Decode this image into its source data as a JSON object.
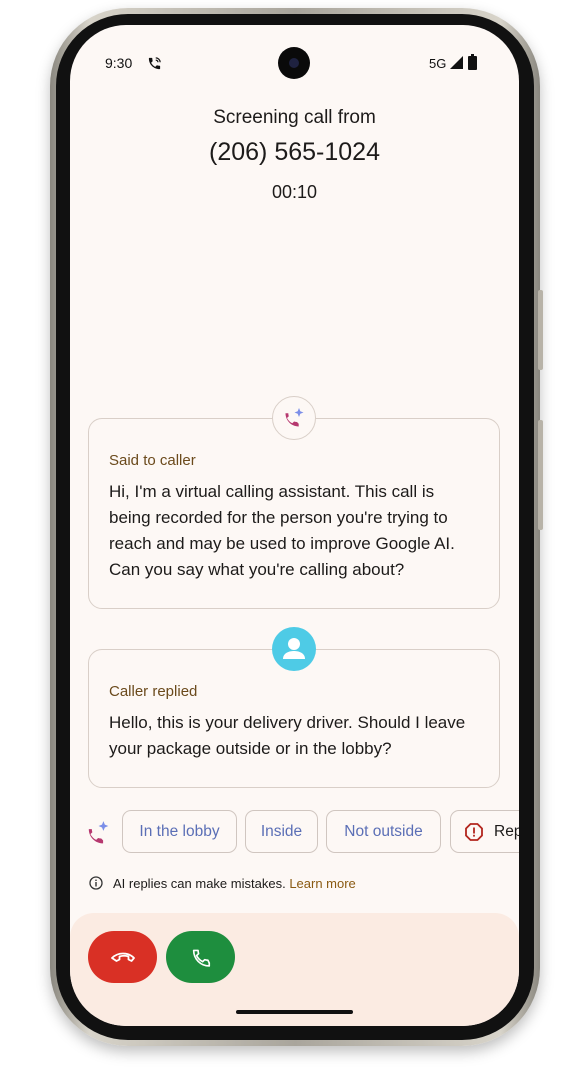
{
  "status_bar": {
    "time": "9:30",
    "network": "5G",
    "icons": [
      "call-in-progress-icon",
      "signal-icon",
      "battery-icon"
    ]
  },
  "header": {
    "title": "Screening call from",
    "phone_number": "(206) 565-1024",
    "timer": "00:10"
  },
  "messages": [
    {
      "label": "Said to caller",
      "text": "Hi, I'm a virtual calling assistant. This call is being recorded for the person you're trying to reach and may be used to improve Google AI. Can you say what you're calling about?",
      "icon": "ai-phone-sparkle-icon"
    },
    {
      "label": "Caller replied",
      "text": "Hello, this is your delivery driver. Should I leave your package outside or in the lobby?",
      "icon": "person-avatar-icon"
    }
  ],
  "suggested_replies": [
    "In the lobby",
    "Inside",
    "Not outside"
  ],
  "report_chip": {
    "label": "Rep",
    "icon": "report-icon"
  },
  "disclaimer": {
    "text": "AI replies can make mistakes.",
    "link": "Learn more"
  },
  "actions": {
    "decline_icon": "hang-up-icon",
    "answer_icon": "phone-icon"
  },
  "colors": {
    "decline": "#d93025",
    "answer": "#1e8e3e",
    "chip_text": "#5b6fb6",
    "label": "#6b4a1c",
    "avatar": "#4ecbe6"
  }
}
